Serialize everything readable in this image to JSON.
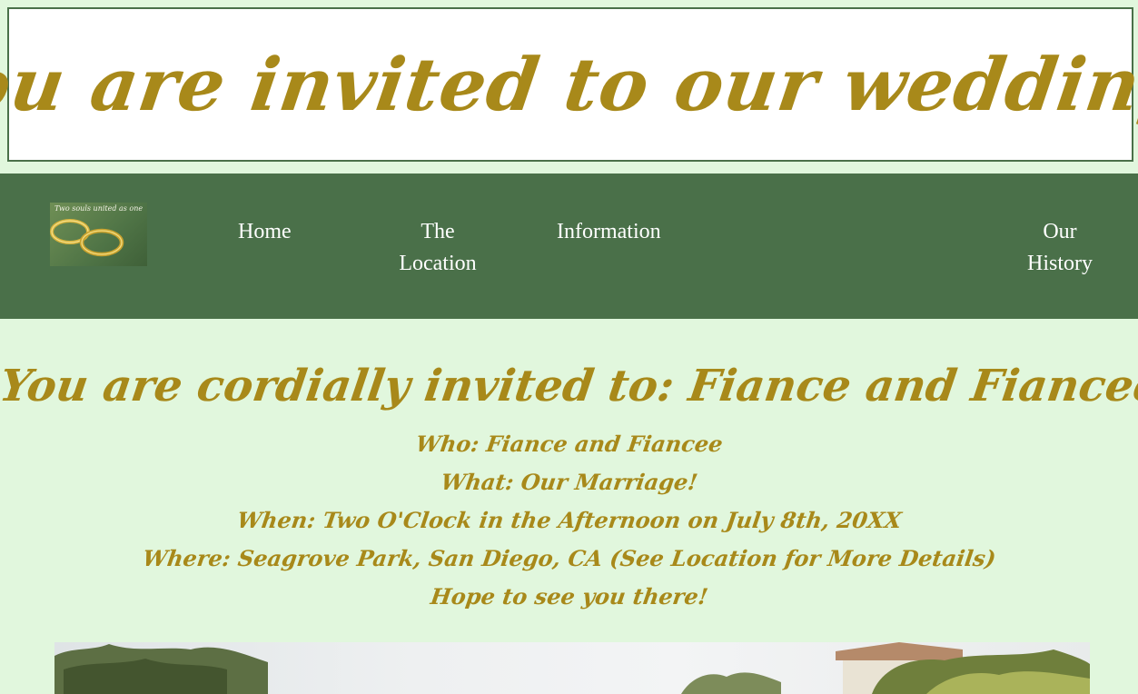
{
  "banner": {
    "title": "You are invited to our wedding!"
  },
  "logo": {
    "caption": "Two souls united as one",
    "icon": "wedding-rings"
  },
  "nav": {
    "home": "Home",
    "location_line1": "The",
    "location_line2": "Location",
    "information": "Information",
    "history_line1": "Our",
    "history_line2": "History"
  },
  "main": {
    "heading": "You are cordially invited to: Fiance and Fiancee's wedding",
    "details": [
      "Who: Fiance and Fiancee",
      "What: Our Marriage!",
      "When: Two O'Clock in the Afternoon on July 8th, 20XX",
      "Where: Seagrove Park, San Diego, CA (See Location for More Details)",
      "Hope to see you there!"
    ]
  },
  "colors": {
    "page_background": "#e1f7dd",
    "nav_background": "#4a7049",
    "script_gold": "#a8891a",
    "banner_background": "#ffffff"
  }
}
